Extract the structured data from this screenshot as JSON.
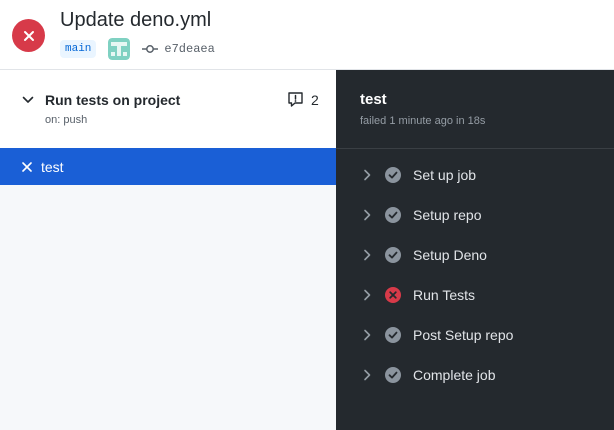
{
  "run": {
    "title": "Update deno.yml",
    "status": "failure",
    "branch": "main",
    "commit_sha": "e7deaea"
  },
  "workflow": {
    "name": "Run tests on project",
    "trigger": "on: push",
    "annotation_count": "2"
  },
  "jobs": [
    {
      "name": "test",
      "status": "failure",
      "selected": true
    }
  ],
  "job_detail": {
    "title": "test",
    "subtitle": "failed 1 minute ago in 18s",
    "steps": [
      {
        "name": "Set up job",
        "status": "success"
      },
      {
        "name": "Setup repo",
        "status": "success"
      },
      {
        "name": "Setup Deno",
        "status": "success"
      },
      {
        "name": "Run Tests",
        "status": "failure"
      },
      {
        "name": "Post Setup repo",
        "status": "success"
      },
      {
        "name": "Complete job",
        "status": "success"
      }
    ]
  },
  "colors": {
    "failure": "#d73a49",
    "success_icon": "#8b949e",
    "selected_row": "#1a5fd6",
    "dark_panel": "#24292e"
  },
  "icons": {
    "status": "x-circle-icon",
    "avatar": "user-avatar",
    "commit": "git-commit-icon",
    "comment": "comment-alert-icon",
    "chevron": "chevron-icon"
  }
}
